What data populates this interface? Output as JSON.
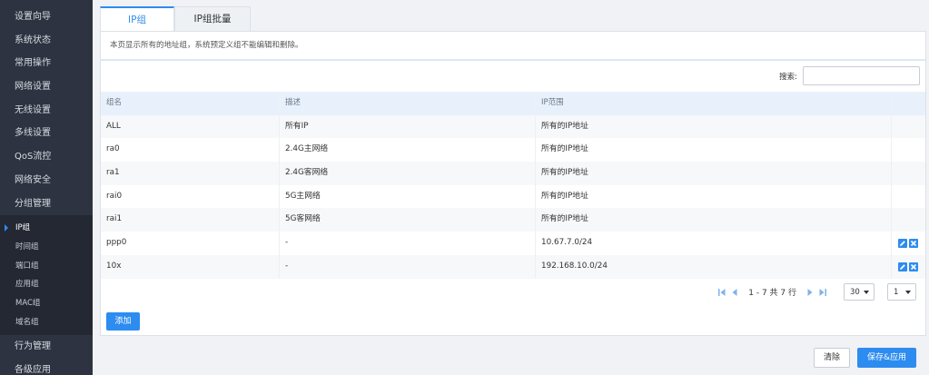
{
  "sidebar": {
    "items_top": [
      "设置向导",
      "系统状态",
      "常用操作",
      "网络设置",
      "无线设置",
      "多线设置",
      "QoS流控",
      "网络安全",
      "分组管理"
    ],
    "sub_items": [
      "IP组",
      "时间组",
      "端口组",
      "应用组",
      "MAC组",
      "域名组"
    ],
    "active_sub": "IP组",
    "items_bottom": [
      "行为管理",
      "各级应用"
    ]
  },
  "tabs": [
    {
      "label": "IP组",
      "active": true
    },
    {
      "label": "IP组批量",
      "active": false
    }
  ],
  "info_text": "本页显示所有的地址组，系统预定义组不能编辑和删除。",
  "search": {
    "label": "搜索:",
    "value": ""
  },
  "table": {
    "headers": [
      "组名",
      "描述",
      "IP范围"
    ],
    "rows": [
      {
        "name": "ALL",
        "desc": "所有IP",
        "range": "所有的IP地址",
        "editable": false
      },
      {
        "name": "ra0",
        "desc": "2.4G主网络",
        "range": "所有的IP地址",
        "editable": false
      },
      {
        "name": "ra1",
        "desc": "2.4G客网络",
        "range": "所有的IP地址",
        "editable": false
      },
      {
        "name": "rai0",
        "desc": "5G主网络",
        "range": "所有的IP地址",
        "editable": false
      },
      {
        "name": "rai1",
        "desc": "5G客网络",
        "range": "所有的IP地址",
        "editable": false
      },
      {
        "name": "ppp0",
        "desc": "-",
        "range": "10.67.7.0/24",
        "editable": true
      },
      {
        "name": "10x",
        "desc": "-",
        "range": "192.168.10.0/24",
        "editable": true
      }
    ]
  },
  "pagination": {
    "text": "1 - 7 共 7 行",
    "page_size": "30",
    "page": "1"
  },
  "buttons": {
    "add": "添加",
    "clear": "清除",
    "save": "保存&应用"
  },
  "colors": {
    "accent": "#2d8cf0",
    "sidebar_bg": "#2d3340"
  }
}
